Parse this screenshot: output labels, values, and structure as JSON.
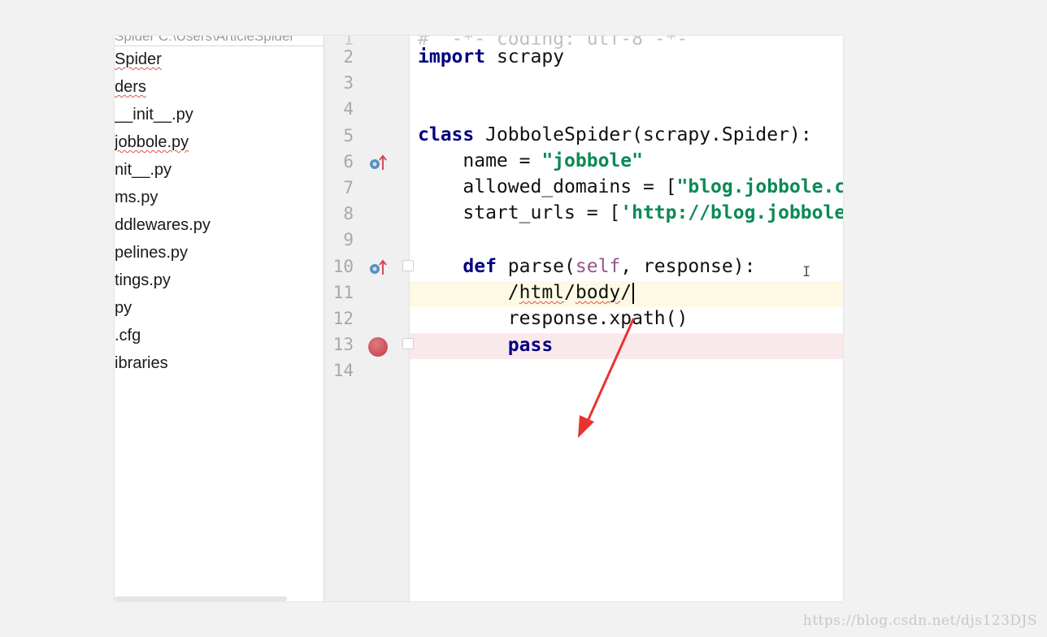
{
  "tree": {
    "header_text": "Spider  C:\\Users\\ArticleSpider",
    "items": [
      {
        "label": "Spider",
        "squiggle": true
      },
      {
        "label": "ders",
        "squiggle": true
      },
      {
        "label": "__init__.py",
        "squiggle": false
      },
      {
        "label": "jobbole.py",
        "squiggle": true
      },
      {
        "label": "nit__.py",
        "squiggle": false
      },
      {
        "label": "ms.py",
        "squiggle": false
      },
      {
        "label": "ddlewares.py",
        "squiggle": false
      },
      {
        "label": "pelines.py",
        "squiggle": false
      },
      {
        "label": "tings.py",
        "squiggle": false
      },
      {
        "label": "py",
        "squiggle": false
      },
      {
        "label": ".cfg",
        "squiggle": false
      },
      {
        "label": "ibraries",
        "squiggle": false
      }
    ]
  },
  "editor": {
    "line_numbers": [
      "2",
      "3",
      "4",
      "5",
      "6",
      "7",
      "8",
      "9",
      "10",
      "11",
      "12",
      "13",
      "14"
    ],
    "code": {
      "l2_kw": "import",
      "l2_rest": " scrapy",
      "l5_kw": "class",
      "l5_rest": " JobboleSpider(scrapy.Spider):",
      "l6_pre": "    name = ",
      "l6_str": "\"jobbole\"",
      "l7_pre": "    allowed_domains = [",
      "l7_str": "\"blog.jobbole.com\"]",
      "l8_pre": "    start_urls = [",
      "l8_str": "'http://blog.jobbole.com/'",
      "l10_pre": "    ",
      "l10_kw": "def",
      "l10_mid": " parse(",
      "l10_self": "self",
      "l10_rest": ", response):",
      "l11_pre": "        /",
      "l11_sq1": "html",
      "l11_mid": "/",
      "l11_sq2": "body",
      "l11_end": "/",
      "l12": "        response.xpath()",
      "l13_pre": "        ",
      "l13_kw": "pass"
    }
  },
  "colors": {
    "keyword": "#000080",
    "string": "#0b8a55",
    "self": "#94558d",
    "current_line": "#fdf9e4",
    "breakpoint_line": "#fae9eb",
    "arrow": "#e8332f"
  },
  "watermark": "https://blog.csdn.net/djs123DJS"
}
